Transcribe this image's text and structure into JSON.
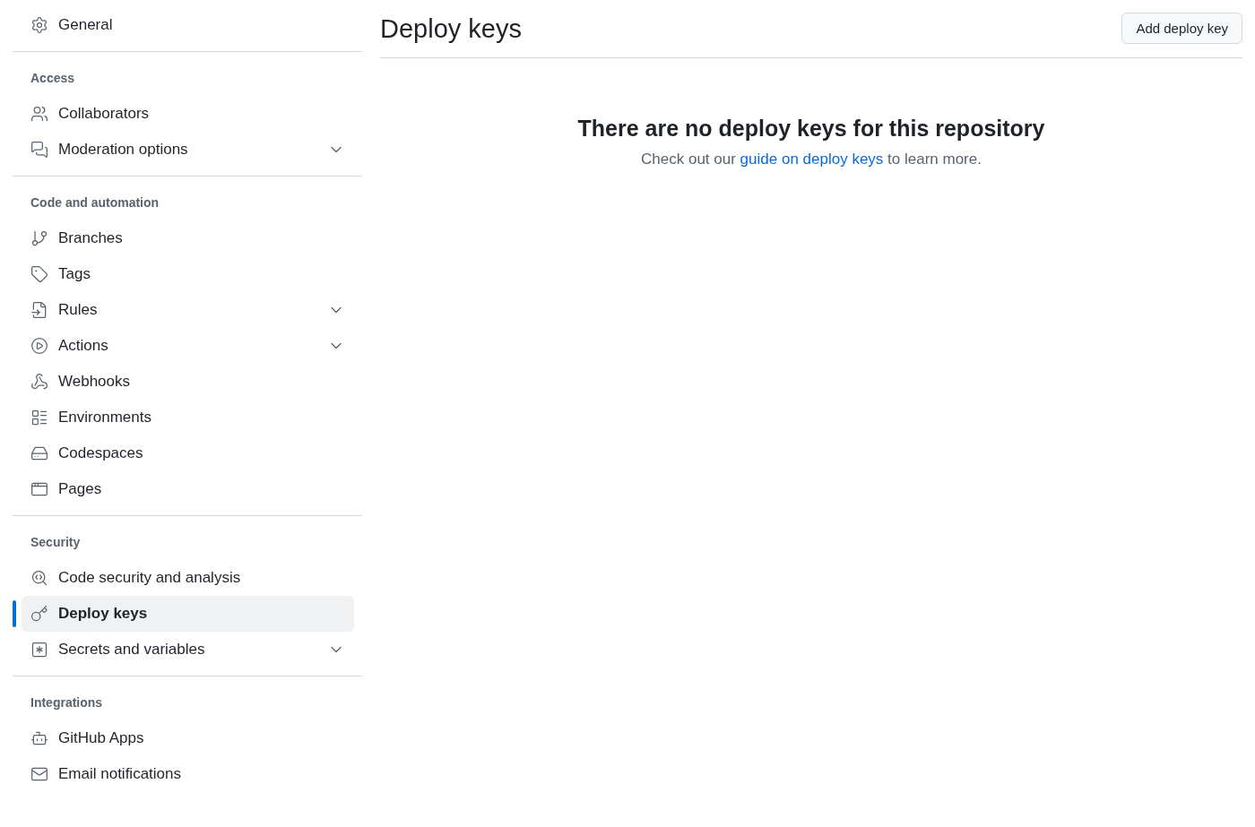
{
  "sidebar": {
    "top": {
      "label": "General",
      "kind": "gear",
      "has_submenu": false,
      "selected": false
    },
    "sections": [
      {
        "heading": "Access",
        "items": [
          {
            "label": "Collaborators",
            "kind": "people",
            "has_submenu": false,
            "selected": false
          },
          {
            "label": "Moderation options",
            "kind": "chat",
            "has_submenu": true,
            "selected": false
          }
        ]
      },
      {
        "heading": "Code and automation",
        "items": [
          {
            "label": "Branches",
            "kind": "branch",
            "has_submenu": false,
            "selected": false
          },
          {
            "label": "Tags",
            "kind": "tag",
            "has_submenu": false,
            "selected": false
          },
          {
            "label": "Rules",
            "kind": "rules",
            "has_submenu": true,
            "selected": false
          },
          {
            "label": "Actions",
            "kind": "play",
            "has_submenu": true,
            "selected": false
          },
          {
            "label": "Webhooks",
            "kind": "webhook",
            "has_submenu": false,
            "selected": false
          },
          {
            "label": "Environments",
            "kind": "list",
            "has_submenu": false,
            "selected": false
          },
          {
            "label": "Codespaces",
            "kind": "drive",
            "has_submenu": false,
            "selected": false
          },
          {
            "label": "Pages",
            "kind": "window",
            "has_submenu": false,
            "selected": false
          }
        ]
      },
      {
        "heading": "Security",
        "items": [
          {
            "label": "Code security and analysis",
            "kind": "codescan",
            "has_submenu": false,
            "selected": false
          },
          {
            "label": "Deploy keys",
            "kind": "key",
            "has_submenu": false,
            "selected": true
          },
          {
            "label": "Secrets and variables",
            "kind": "asterisk",
            "has_submenu": true,
            "selected": false
          }
        ]
      },
      {
        "heading": "Integrations",
        "items": [
          {
            "label": "GitHub Apps",
            "kind": "bot",
            "has_submenu": false,
            "selected": false
          },
          {
            "label": "Email notifications",
            "kind": "mail",
            "has_submenu": false,
            "selected": false
          }
        ]
      }
    ]
  },
  "main": {
    "title": "Deploy keys",
    "button": "Add deploy key",
    "empty_state": {
      "heading": "There are no deploy keys for this repository",
      "before": "Check out our ",
      "link": "guide on deploy keys",
      "after": " to learn more."
    }
  }
}
